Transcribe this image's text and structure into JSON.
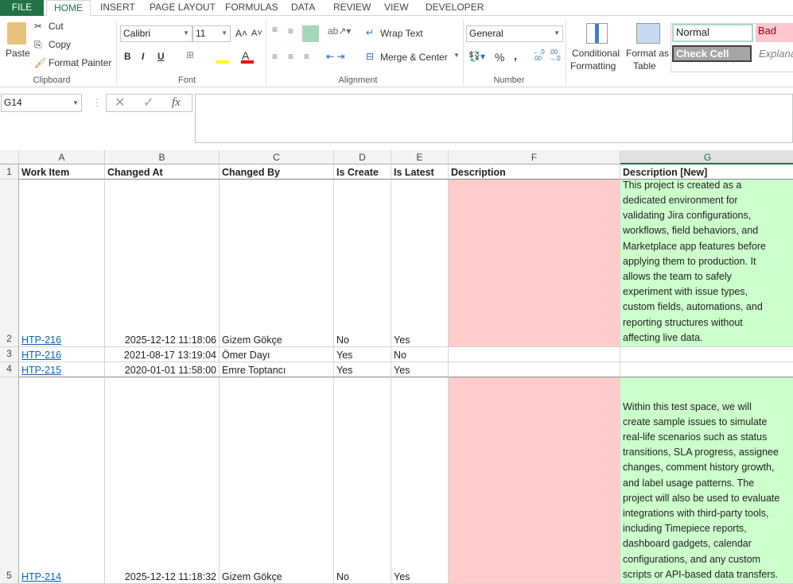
{
  "tabs": [
    "FILE",
    "HOME",
    "INSERT",
    "PAGE LAYOUT",
    "FORMULAS",
    "DATA",
    "REVIEW",
    "VIEW",
    "DEVELOPER"
  ],
  "clipboard": {
    "paste": "Paste",
    "cut": "Cut",
    "copy": "Copy",
    "format_painter": "Format Painter",
    "group": "Clipboard"
  },
  "font": {
    "name": "Calibri",
    "size": "11",
    "bold": "B",
    "italic": "I",
    "underline": "U",
    "group": "Font"
  },
  "alignment": {
    "wrap_text": "Wrap Text",
    "merge_center": "Merge & Center",
    "group": "Alignment"
  },
  "number": {
    "format": "General",
    "percent": "%",
    "comma": ",",
    "group": "Number"
  },
  "styles": {
    "conditional": "Conditional",
    "formatting": "Formatting",
    "format_as": "Format as",
    "table": "Table",
    "normal": "Normal",
    "bad": "Bad",
    "check_cell": "Check Cell",
    "explanatory": "Explanat"
  },
  "formula_bar": {
    "name_box": "G14",
    "fx": "fx",
    "value": ""
  },
  "columns": [
    "A",
    "B",
    "C",
    "D",
    "E",
    "F",
    "G"
  ],
  "headers": [
    "Work Item",
    "Changed At",
    "Changed By",
    "Is Create",
    "Is Latest",
    "Description",
    "Description [New]"
  ],
  "rows": [
    {
      "num": "2",
      "work_item": "HTP-216",
      "changed_at": "2025-12-12 11:18:06",
      "changed_by": "Gizem Gökçe",
      "is_create": "No",
      "is_latest": "Yes",
      "description": "",
      "description_new": [
        "This project is created as a",
        "dedicated environment for",
        "validating Jira configurations,",
        "workflows, field behaviors, and",
        "Marketplace app features before",
        "applying them to production. It",
        "allows the team to safely",
        "experiment with issue types,",
        "custom fields, automations, and",
        "reporting structures without",
        "affecting live data."
      ]
    },
    {
      "num": "3",
      "work_item": "HTP-216",
      "changed_at": "2021-08-17 13:19:04",
      "changed_by": "Ömer Dayı",
      "is_create": "Yes",
      "is_latest": "No",
      "description": "",
      "description_new": []
    },
    {
      "num": "4",
      "work_item": "HTP-215",
      "changed_at": "2020-01-01 11:58:00",
      "changed_by": "Emre Toptancı",
      "is_create": "Yes",
      "is_latest": "Yes",
      "description": "",
      "description_new": []
    },
    {
      "num": "5",
      "work_item": "HTP-214",
      "changed_at": "2025-12-12 11:18:32",
      "changed_by": "Gizem Gökçe",
      "is_create": "No",
      "is_latest": "Yes",
      "description": "",
      "description_new": [
        "Within this test space, we will",
        "create sample issues to simulate",
        "real-life scenarios such as status",
        "transitions, SLA progress, assignee",
        "changes, comment history growth,",
        "and label usage patterns. The",
        "project will also be used to evaluate",
        "integrations with third-party tools,",
        "including Timepiece reports,",
        "dashboard gadgets, calendar",
        "configurations, and any custom",
        "scripts or API-based data transfers."
      ]
    }
  ]
}
